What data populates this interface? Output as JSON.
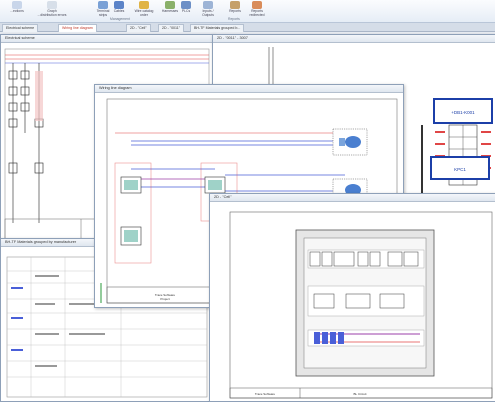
{
  "ribbon": {
    "buttons": [
      {
        "label": "...ections",
        "icon": "connections-icon",
        "color": "#c9d6ea"
      },
      {
        "label": "Graph",
        "label2": "...distribution errors",
        "icon": "graph-icon",
        "color": "#d7dfe9"
      },
      {
        "label": "Terminal",
        "label2": "strips",
        "icon": "terminal-strips-icon",
        "color": "#7aa1d6"
      },
      {
        "label": "Cables",
        "icon": "cables-icon",
        "color": "#5c84c8"
      },
      {
        "label": "Wire catalog",
        "label2": "order",
        "icon": "wire-catalog-icon",
        "color": "#e0b447"
      },
      {
        "label": "Harnesses",
        "icon": "harnesses-icon",
        "color": "#8ab06a"
      },
      {
        "label": "PLCs",
        "icon": "plcs-icon",
        "color": "#6c8fc6"
      },
      {
        "label": "Inputs /",
        "label2": "Outputs",
        "icon": "inputs-outputs-icon",
        "color": "#9db4d6"
      },
      {
        "label": "Reports",
        "icon": "reports-icon",
        "color": "#c5a06a"
      },
      {
        "label": "Reports",
        "label2": "redirected",
        "icon": "reports-redirected-icon",
        "color": "#d98c5a"
      }
    ],
    "groups": {
      "management": "Management",
      "reports": "Reports"
    }
  },
  "tabs": [
    {
      "label": "Electrical scheme",
      "active": false
    },
    {
      "label": "Wiring line diagram",
      "active": true
    },
    {
      "label": "2D - \"Cell\"",
      "active": false
    },
    {
      "label": "2D - \"0011\"",
      "active": false
    },
    {
      "label": "BH-TF Materials grouped b...",
      "active": false
    }
  ],
  "windows": {
    "electrical": {
      "title": "Electrical scheme"
    },
    "cabinet2d": {
      "title": "2D - \"0011\" - 3007"
    },
    "wiring": {
      "title": "Wiring line diagram"
    },
    "cell2d": {
      "title": "2D - \"Cell\""
    },
    "materials": {
      "title": "BH-TF Materials grouped by manufacturer"
    }
  },
  "diagram": {
    "device_a": "+DB1-K001",
    "device_b": "KPC1",
    "title_block": {
      "company": "Trace Software",
      "project": "Project",
      "label": "BL Circuit"
    }
  },
  "colors": {
    "accent": "#1c3fa8",
    "wire_blue": "#4a5fd8",
    "wire_red": "#e04646",
    "wire_purple": "#9b3fa8"
  }
}
